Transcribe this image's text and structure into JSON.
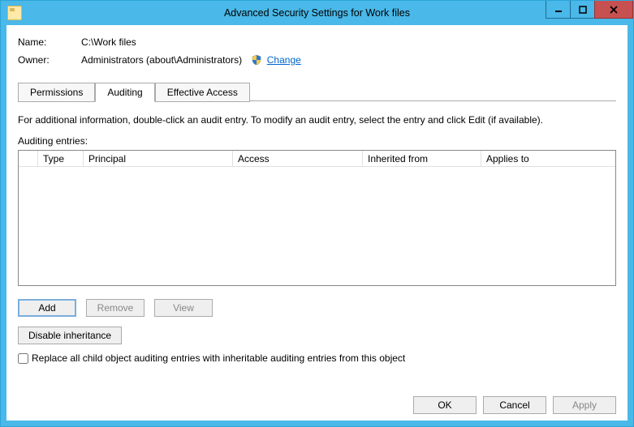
{
  "window": {
    "title": "Advanced Security Settings for Work files"
  },
  "info": {
    "name_label": "Name:",
    "name_value": "C:\\Work files",
    "owner_label": "Owner:",
    "owner_value": "Administrators (about\\Administrators)",
    "change_link": "Change"
  },
  "tabs": {
    "permissions": "Permissions",
    "auditing": "Auditing",
    "effective": "Effective Access"
  },
  "body": {
    "description": "For additional information, double-click an audit entry. To modify an audit entry, select the entry and click Edit (if available).",
    "entries_label": "Auditing entries:"
  },
  "columns": {
    "type": "Type",
    "principal": "Principal",
    "access": "Access",
    "inherited": "Inherited from",
    "applies": "Applies to"
  },
  "buttons": {
    "add": "Add",
    "remove": "Remove",
    "view": "View",
    "disable_inheritance": "Disable inheritance",
    "ok": "OK",
    "cancel": "Cancel",
    "apply": "Apply"
  },
  "checkbox": {
    "replace_label": "Replace all child object auditing entries with inheritable auditing entries from this object"
  }
}
